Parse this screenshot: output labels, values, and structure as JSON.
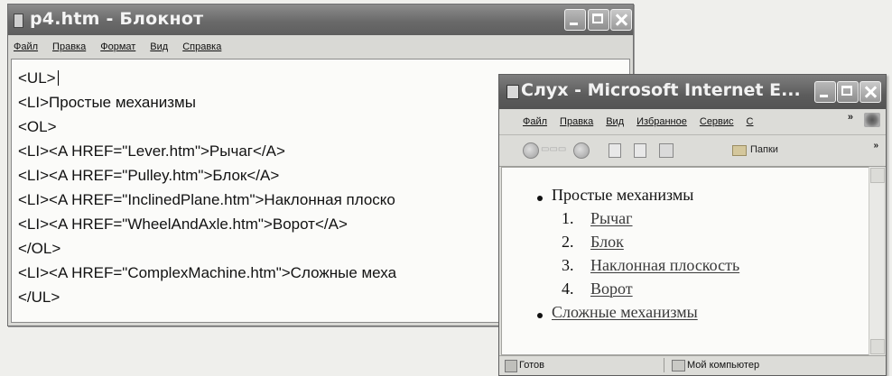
{
  "notepad": {
    "title": "p4.htm - Блокнот",
    "menu": [
      "Файл",
      "Правка",
      "Формат",
      "Вид",
      "Справка"
    ],
    "lines": [
      "<UL>",
      "<LI>Простые механизмы",
      "<OL>",
      "<LI><A HREF=\"Lever.htm\">Рычаг</A>",
      "<LI><A HREF=\"Pulley.htm\">Блок</A>",
      "<LI><A HREF=\"InclinedPlane.htm\">Наклонная плоско",
      "<LI><A HREF=\"WheelAndAxle.htm\">Ворот</A>",
      "</OL>",
      "<LI><A HREF=\"ComplexMachine.htm\">Сложные меха",
      "</UL>"
    ]
  },
  "browser": {
    "title": "Слух - Microsoft Internet E...",
    "menu": [
      "Файл",
      "Правка",
      "Вид",
      "Избранное",
      "Сервис",
      "С"
    ],
    "menu_more": "»",
    "toolbar": {
      "folders_label": "Папки",
      "more": "»"
    },
    "page": {
      "items": [
        {
          "text": "Простые механизмы",
          "sub": [
            "Рычаг",
            "Блок",
            "Наклонная плоскость",
            "Ворот"
          ]
        },
        {
          "text": "Сложные механизмы"
        }
      ],
      "numbers": [
        "1.",
        "2.",
        "3.",
        "4."
      ]
    },
    "status": {
      "text": "Готов",
      "zone": "Мой компьютер"
    }
  }
}
